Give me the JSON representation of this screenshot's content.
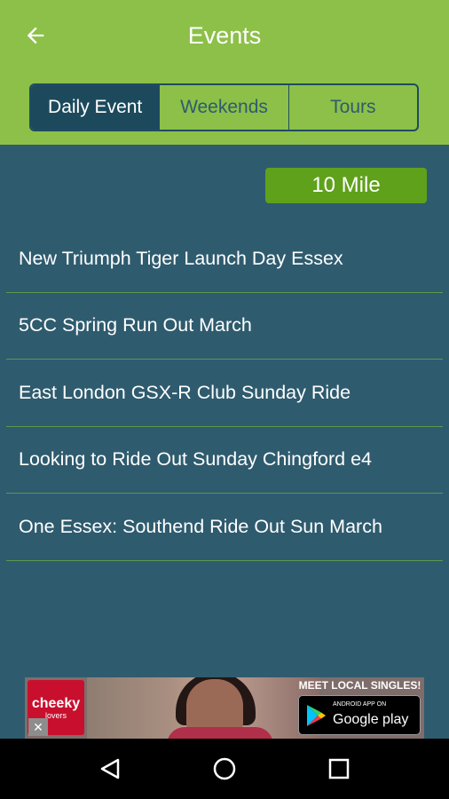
{
  "app_bar": {
    "title": "Events",
    "back_icon": "arrow-left-icon"
  },
  "tabs": [
    {
      "label": "Daily Event",
      "active": true
    },
    {
      "label": "Weekends",
      "active": false
    },
    {
      "label": "Tours",
      "active": false
    }
  ],
  "filter": {
    "label": "10 Mile"
  },
  "events": [
    {
      "title": "New Triumph Tiger Launch Day Essex"
    },
    {
      "title": "5CC Spring Run Out March"
    },
    {
      "title": "East London GSX-R Club Sunday Ride"
    },
    {
      "title": "Looking to Ride Out Sunday Chingford e4"
    },
    {
      "title": "One Essex: Southend Ride Out Sun March"
    }
  ],
  "ad": {
    "brand": "cheeky",
    "brand_sub": "lovers",
    "headline": "MEET LOCAL SINGLES!",
    "badge_top": "ANDROID APP ON",
    "badge_name": "Google play",
    "close_icon": "close-icon"
  },
  "nav_bar": {
    "back_icon": "nav-back-icon",
    "home_icon": "nav-home-icon",
    "recents_icon": "nav-recents-icon"
  },
  "colors": {
    "app_bar": "#8cc048",
    "background": "#2f5b6e",
    "active_tab": "#1c4a5c",
    "filter_button": "#5fa11b",
    "divider": "#5a9a4e"
  }
}
